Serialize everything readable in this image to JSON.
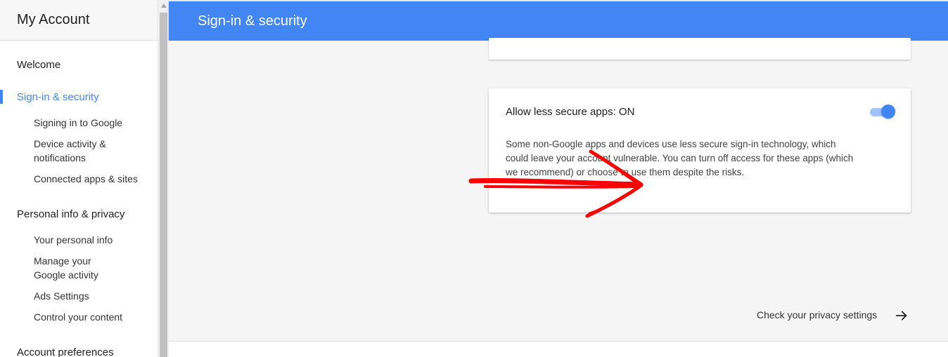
{
  "sidebar": {
    "title": "My Account",
    "sections": [
      {
        "label": "Welcome",
        "active": false,
        "items": []
      },
      {
        "label": "Sign-in & security",
        "active": true,
        "items": [
          "Signing in to Google",
          "Device activity & notifications",
          "Connected apps & sites"
        ]
      },
      {
        "label": "Personal info & privacy",
        "active": false,
        "items": [
          "Your personal info",
          "Manage your Google activity",
          "Ads Settings",
          "Control your content"
        ]
      },
      {
        "label": "Account preferences",
        "active": false,
        "items": []
      }
    ]
  },
  "header": {
    "title": "Sign-in & security"
  },
  "setting_card": {
    "title": "Allow less secure apps: ON",
    "description": "Some non-Google apps and devices use less secure sign-in technology, which could leave your account vulnerable. You can turn off access for these apps (which we recommend) or choose to use them despite the risks.",
    "toggle_on": true
  },
  "footer_link": {
    "label": "Check your privacy settings",
    "icon": "arrow-right-icon"
  },
  "colors": {
    "accent": "#4285f4",
    "annotation": "#ff0000"
  }
}
